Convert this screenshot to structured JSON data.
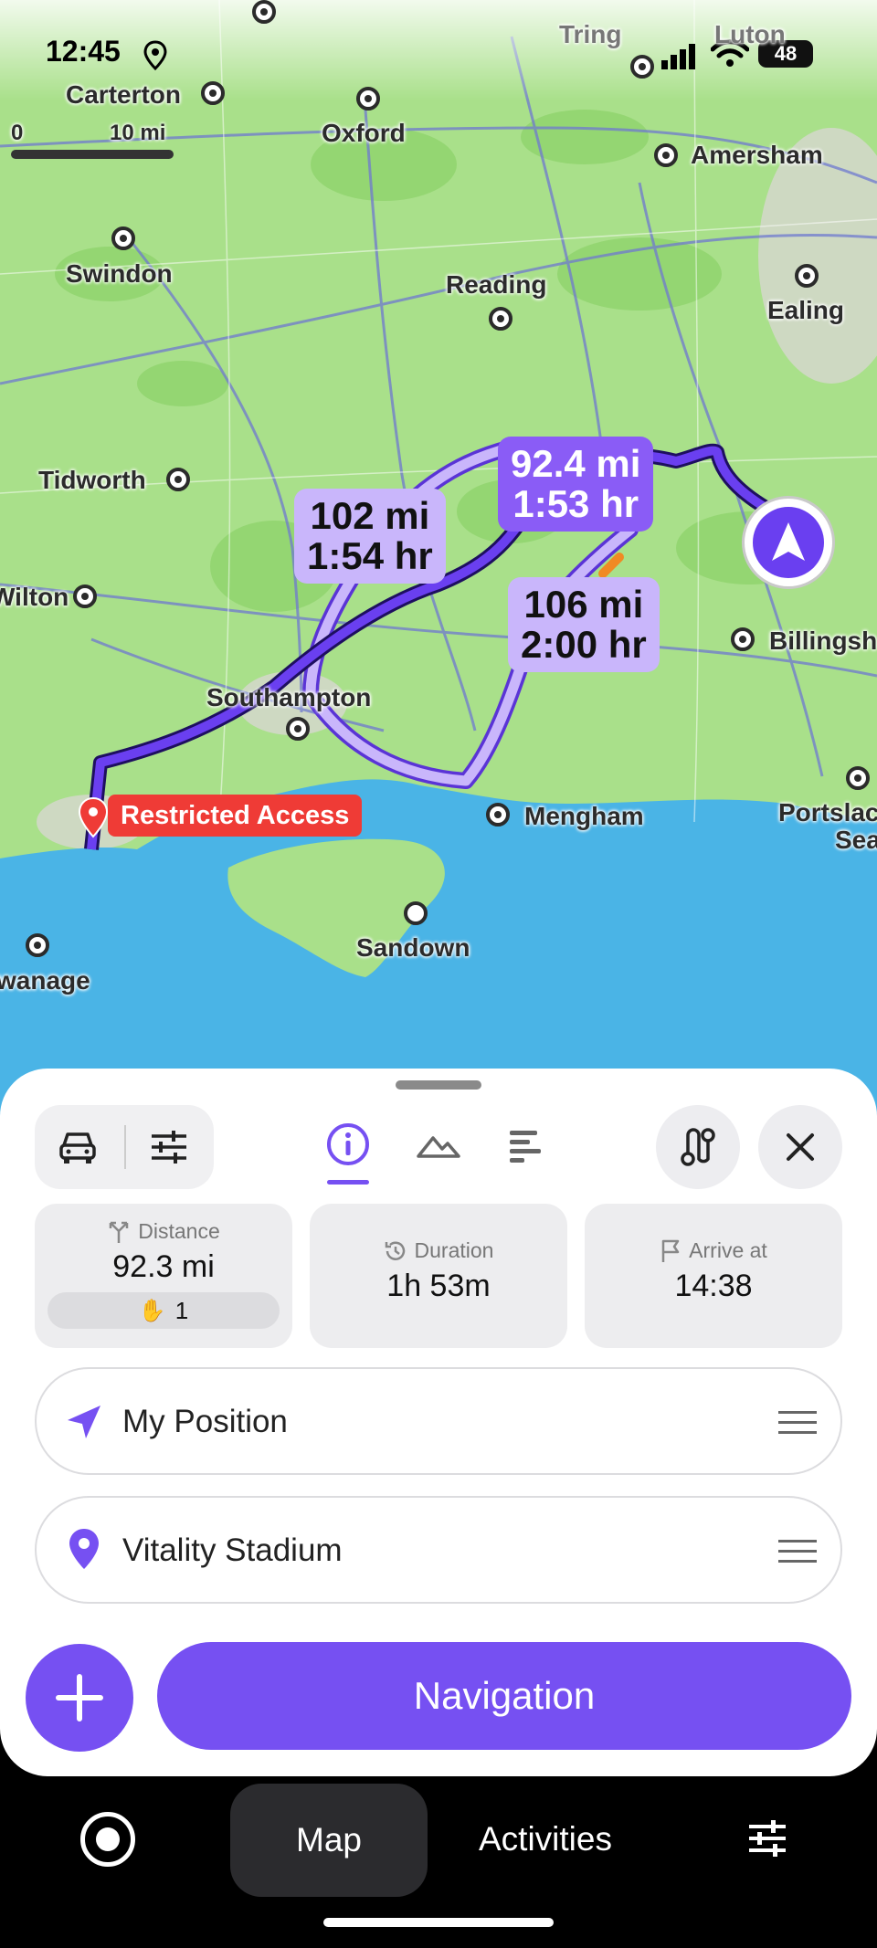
{
  "status_bar": {
    "time": "12:45",
    "battery": "48"
  },
  "map": {
    "scale_start": "0",
    "scale_end": "10 mi",
    "places": [
      {
        "name": "Tring"
      },
      {
        "name": "Luton"
      },
      {
        "name": "Carterton"
      },
      {
        "name": "Oxford"
      },
      {
        "name": "Amersham"
      },
      {
        "name": "Swindon"
      },
      {
        "name": "Reading"
      },
      {
        "name": "Ealing"
      },
      {
        "name": "Tidworth"
      },
      {
        "name": "Wilton"
      },
      {
        "name": "Billingsh"
      },
      {
        "name": "Southampton"
      },
      {
        "name": "Mengham"
      },
      {
        "name": "Portslac"
      },
      {
        "name": "Sea"
      },
      {
        "name": "Sandown"
      },
      {
        "name": "wanage"
      }
    ],
    "routes": [
      {
        "distance": "102 mi",
        "time": "1:54 hr"
      },
      {
        "distance": "92.4 mi",
        "time": "1:53 hr"
      },
      {
        "distance": "106 mi",
        "time": "2:00 hr"
      }
    ],
    "destination_tag": "Restricted Access"
  },
  "sheet": {
    "tabs": [
      "info",
      "elevation",
      "details"
    ],
    "stats": {
      "distance_label": "Distance",
      "distance_value": "92.3 mi",
      "hazards_count": "1",
      "duration_label": "Duration",
      "duration_value": "1h 53m",
      "arrive_label": "Arrive at",
      "arrive_value": "14:38"
    },
    "start_point": "My Position",
    "end_point": "Vitality Stadium",
    "navigation_label": "Navigation"
  },
  "tabbar": {
    "map_label": "Map",
    "activities_label": "Activities"
  },
  "colors": {
    "accent": "#7650f2",
    "route_active": "#6a3ff0",
    "route_alt": "#c9b6fb",
    "sea": "#4ab4e6",
    "land": "#a9e08a",
    "tag_red": "#ef3b36"
  }
}
